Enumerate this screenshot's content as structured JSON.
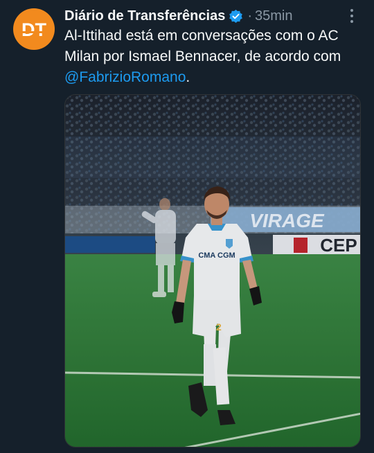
{
  "tweet": {
    "author_name": "Diário de Transferências",
    "avatar_text": "DT",
    "separator": "·",
    "time": "35min",
    "text_before": "Al-Ittihad está em conversações com o AC Milan por Ismael Bennacer, de acordo com ",
    "mention": "@FabrizioRomano",
    "text_after": "."
  },
  "media": {
    "banner_text": "VIRAGE",
    "ad_text": "CEP",
    "shirt_sponsor": "CMA CGM",
    "shirt_number": "2"
  },
  "colors": {
    "background": "#15202b",
    "avatar": "#f28a1e",
    "link": "#1d9bf0",
    "verified": "#1d9bf0",
    "pitch": "#2f7a3a"
  },
  "icons": [
    "verified-badge-icon",
    "more-options-icon"
  ]
}
